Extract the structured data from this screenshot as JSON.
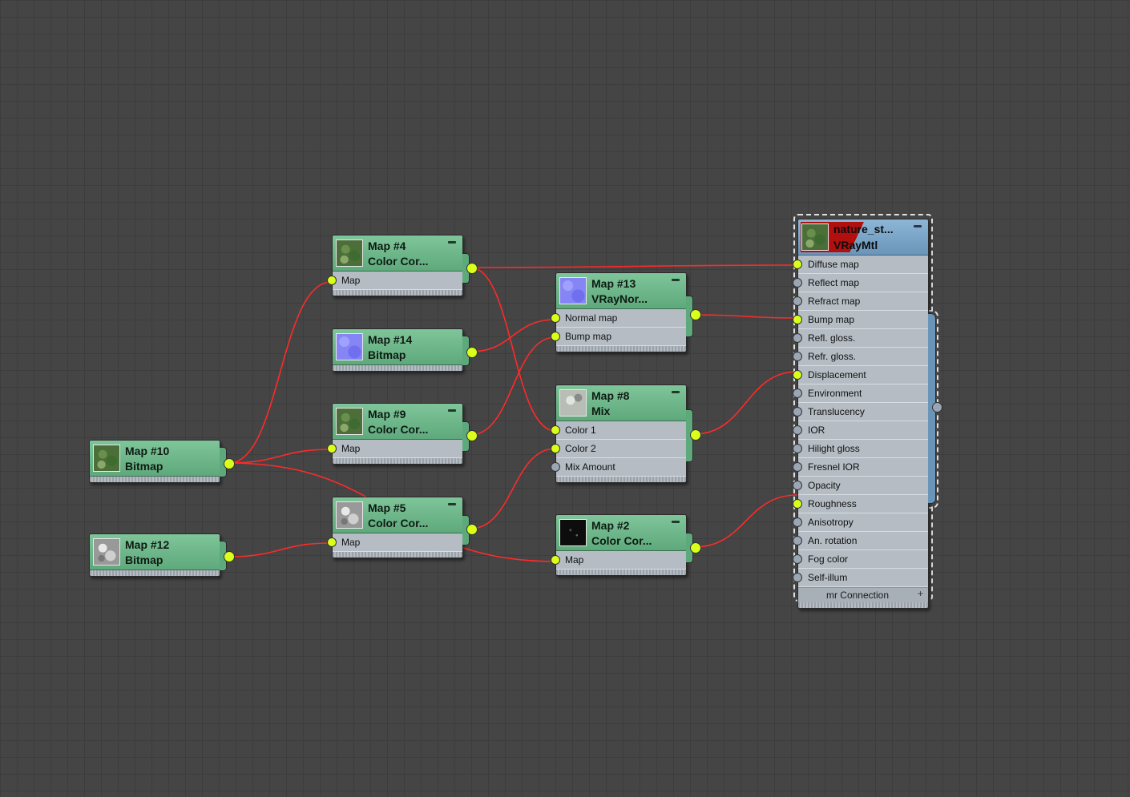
{
  "nodes": {
    "map10": {
      "name": "Map #10",
      "type": "Bitmap",
      "thumb": "foliage-texture"
    },
    "map12": {
      "name": "Map #12",
      "type": "Bitmap",
      "thumb": "grayscale-texture"
    },
    "map4": {
      "name": "Map #4",
      "type": "Color Cor...",
      "thumb": "foliage-texture",
      "slots": [
        "Map"
      ]
    },
    "map14": {
      "name": "Map #14",
      "type": "Bitmap",
      "thumb": "normal-texture"
    },
    "map9": {
      "name": "Map #9",
      "type": "Color Cor...",
      "thumb": "foliage-texture",
      "slots": [
        "Map"
      ]
    },
    "map5": {
      "name": "Map #5",
      "type": "Color Cor...",
      "thumb": "grayscale-texture",
      "slots": [
        "Map"
      ]
    },
    "map13": {
      "name": "Map #13",
      "type": "VRayNor...",
      "thumb": "normal-texture",
      "slots": [
        "Normal map",
        "Bump map"
      ]
    },
    "map8": {
      "name": "Map #8",
      "type": "Mix",
      "thumb": "mix-texture",
      "slots": [
        "Color 1",
        "Color 2",
        "Mix Amount"
      ]
    },
    "map2": {
      "name": "Map #2",
      "type": "Color Cor...",
      "thumb": "dark-texture",
      "slots": [
        "Map"
      ]
    },
    "material": {
      "name": "nature_st...",
      "type": "VRayMtl",
      "thumb": "foliage-texture",
      "slots": [
        "Diffuse map",
        "Reflect map",
        "Refract map",
        "Bump map",
        "Refl. gloss.",
        "Refr. gloss.",
        "Displacement",
        "Environment",
        "Translucency",
        "IOR",
        "Hilight gloss",
        "Fresnel IOR",
        "Opacity",
        "Roughness",
        "Anisotropy",
        "An. rotation",
        "Fog color",
        "Self-illum"
      ],
      "connected_slots": [
        "Diffuse map",
        "Bump map",
        "Displacement",
        "Roughness"
      ],
      "footer": "mr Connection",
      "footer_toggle": "+"
    }
  },
  "colors": {
    "canvas": "#454545",
    "map_node_header": "#6bb286",
    "material_node_header": "#7aa4c6",
    "wire": "#ff2a2a",
    "socket_connected": "#d9ff1a",
    "socket_free": "#9aa6b4"
  }
}
